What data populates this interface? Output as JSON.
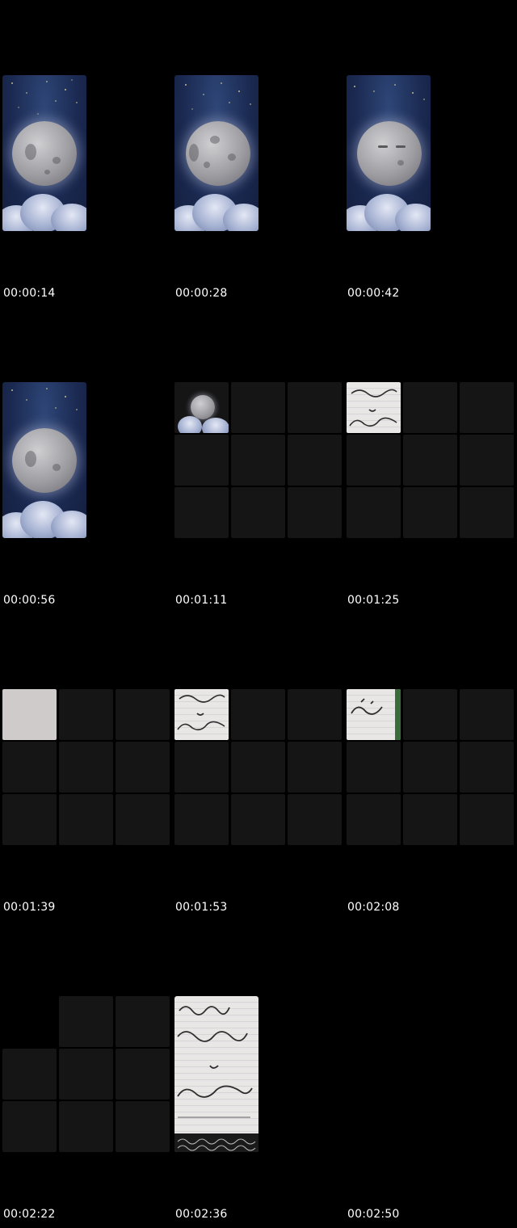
{
  "frames": [
    {
      "timestamp": "00:00:14",
      "kind": "moon"
    },
    {
      "timestamp": "00:00:28",
      "kind": "moon"
    },
    {
      "timestamp": "00:00:42",
      "kind": "moon-face"
    },
    {
      "timestamp": "00:00:56",
      "kind": "moon"
    },
    {
      "timestamp": "00:01:11",
      "kind": "grid-moon"
    },
    {
      "timestamp": "00:01:25",
      "kind": "grid-paper"
    },
    {
      "timestamp": "00:01:39",
      "kind": "grid-blank-paper"
    },
    {
      "timestamp": "00:01:53",
      "kind": "grid-paper"
    },
    {
      "timestamp": "00:02:08",
      "kind": "grid-paper"
    },
    {
      "timestamp": "00:02:22",
      "kind": "grid-empty"
    },
    {
      "timestamp": "00:02:36",
      "kind": "paper-full"
    },
    {
      "timestamp": "00:02:50",
      "kind": "empty"
    }
  ],
  "colors": {
    "background": "#000000",
    "timestamp_text": "#ffffff",
    "night_sky": "#1b2a52",
    "grid_cell": "#151515",
    "paper": "#e9e6e6"
  }
}
